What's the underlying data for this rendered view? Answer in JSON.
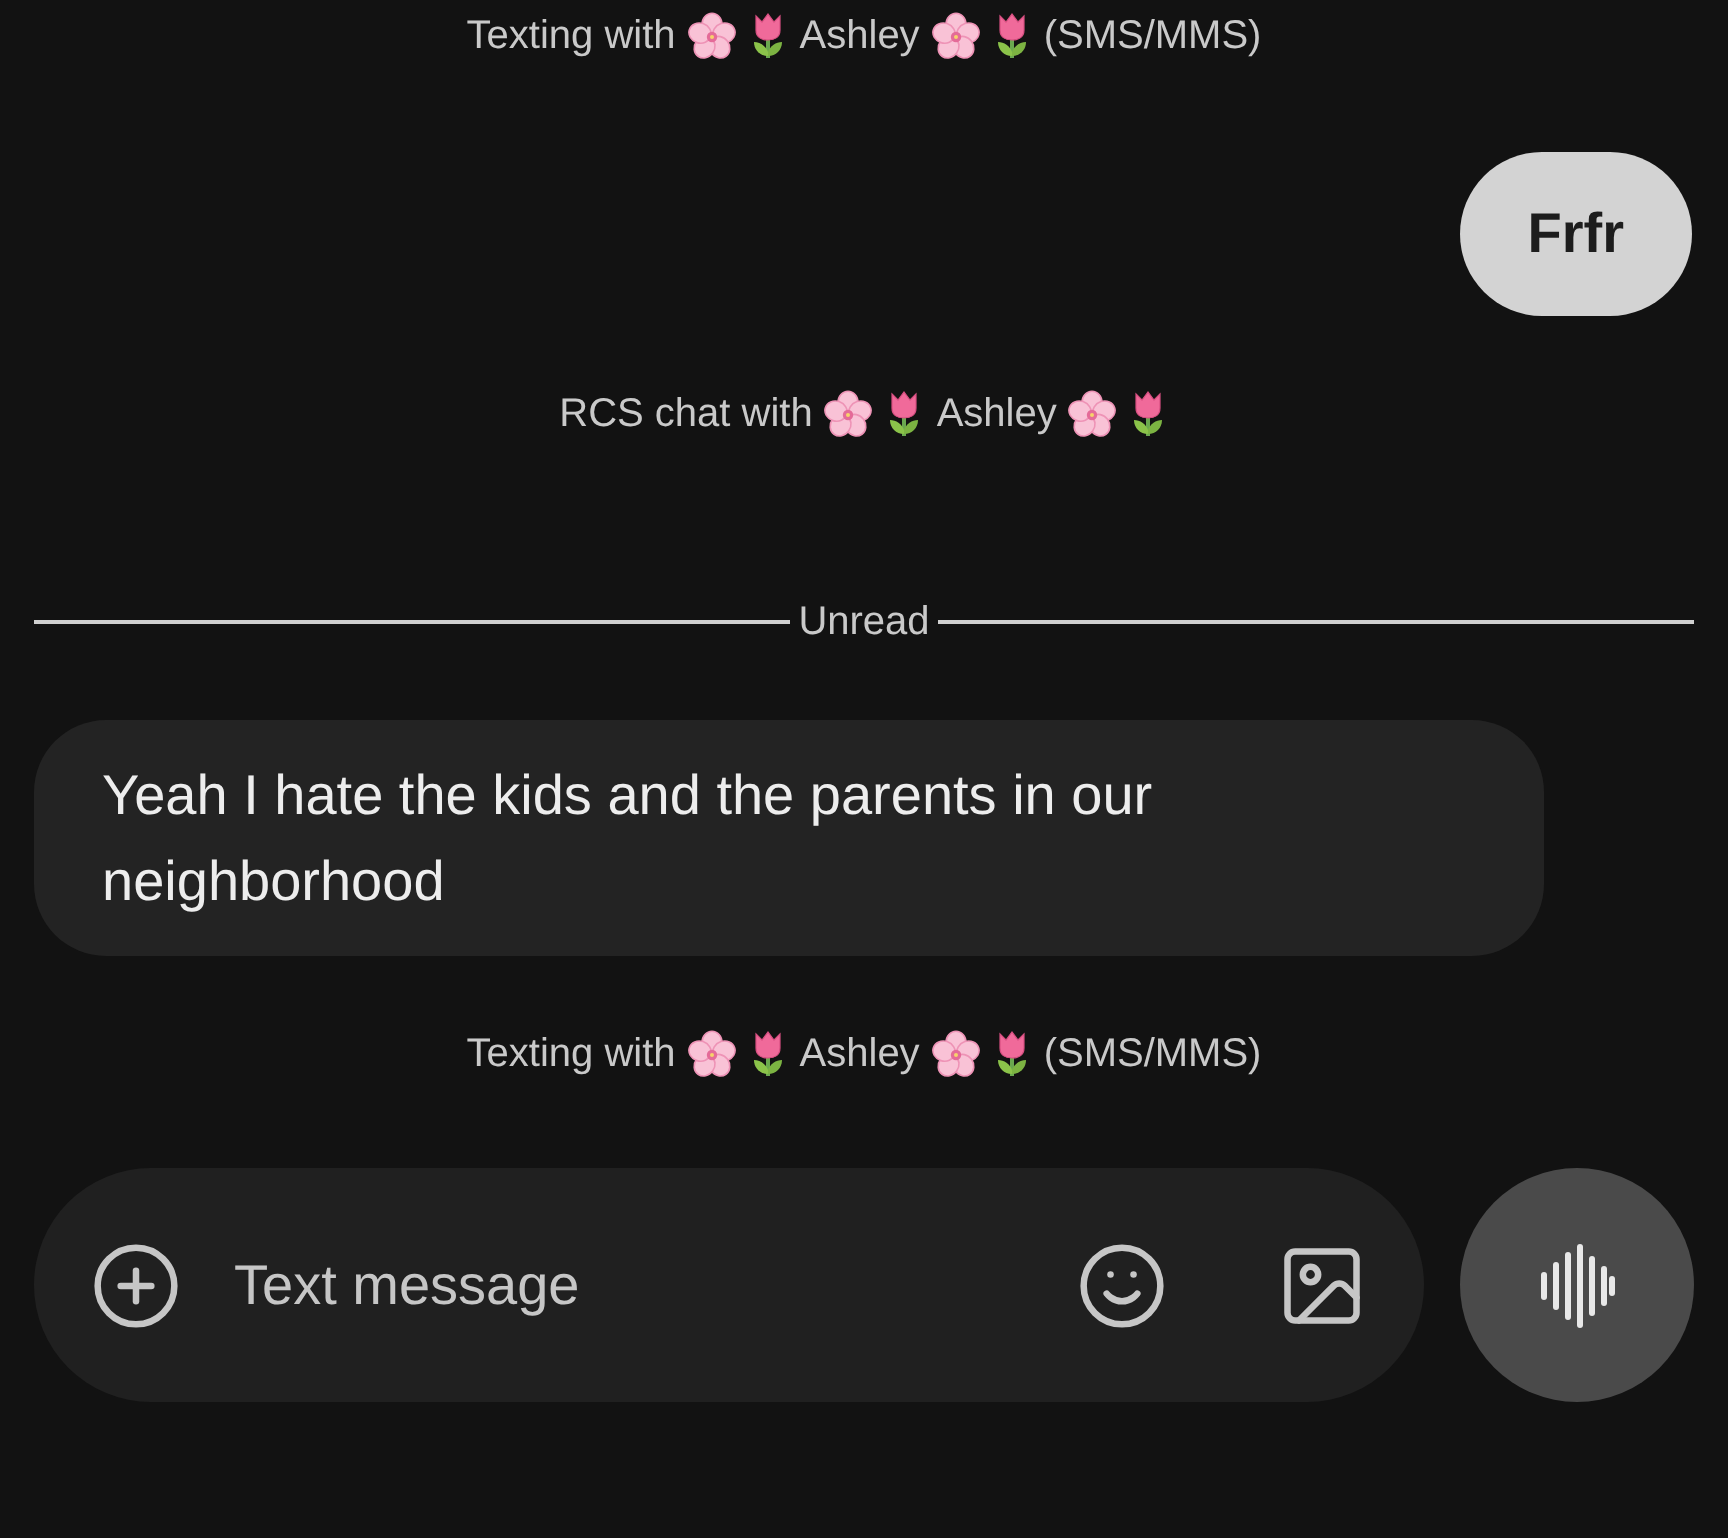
{
  "thread": [
    {
      "kind": "status",
      "parts": [
        {
          "kind": "text",
          "text": "Texting with"
        },
        {
          "kind": "blossom"
        },
        {
          "kind": "tulip"
        },
        {
          "kind": "text",
          "text": "Ashley"
        },
        {
          "kind": "blossom"
        },
        {
          "kind": "tulip"
        },
        {
          "kind": "text",
          "text": "(SMS/MMS)"
        }
      ]
    },
    {
      "kind": "sent",
      "text": "Frfr"
    },
    {
      "kind": "status",
      "parts": [
        {
          "kind": "text",
          "text": "RCS chat with"
        },
        {
          "kind": "blossom"
        },
        {
          "kind": "tulip"
        },
        {
          "kind": "text",
          "text": "Ashley"
        },
        {
          "kind": "blossom"
        },
        {
          "kind": "tulip"
        }
      ]
    },
    {
      "kind": "divider",
      "label": "Unread"
    },
    {
      "kind": "received",
      "text": "Yeah I hate the kids and the parents in our neighborhood"
    },
    {
      "kind": "status",
      "parts": [
        {
          "kind": "text",
          "text": "Texting with"
        },
        {
          "kind": "blossom"
        },
        {
          "kind": "tulip"
        },
        {
          "kind": "text",
          "text": "Ashley"
        },
        {
          "kind": "blossom"
        },
        {
          "kind": "tulip"
        },
        {
          "kind": "text",
          "text": "(SMS/MMS)"
        }
      ]
    }
  ],
  "composer": {
    "placeholder": "Text message"
  }
}
